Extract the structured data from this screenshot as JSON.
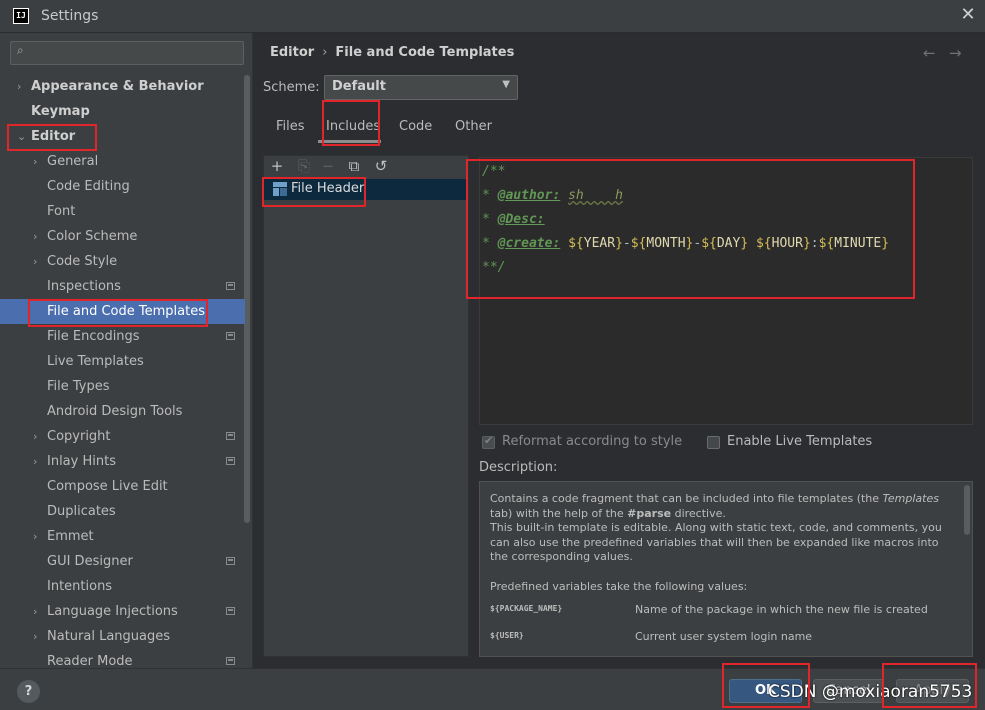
{
  "window": {
    "title": "Settings",
    "app_icon_text": "IJ"
  },
  "search": {
    "placeholder": ""
  },
  "sidebar": {
    "items": [
      {
        "label": "Appearance & Behavior",
        "chevron": "›",
        "bold": true
      },
      {
        "label": "Keymap",
        "bold": true
      },
      {
        "label": "Editor",
        "chevron": "⌄",
        "bold": true
      },
      {
        "label": "General",
        "chevron": "›"
      },
      {
        "label": "Code Editing"
      },
      {
        "label": "Font"
      },
      {
        "label": "Color Scheme",
        "chevron": "›"
      },
      {
        "label": "Code Style",
        "chevron": "›"
      },
      {
        "label": "Inspections",
        "project_icon": true
      },
      {
        "label": "File and Code Templates",
        "selected": true
      },
      {
        "label": "File Encodings",
        "project_icon": true
      },
      {
        "label": "Live Templates"
      },
      {
        "label": "File Types"
      },
      {
        "label": "Android Design Tools"
      },
      {
        "label": "Copyright",
        "chevron": "›",
        "project_icon": true
      },
      {
        "label": "Inlay Hints",
        "chevron": "›",
        "project_icon": true
      },
      {
        "label": "Compose Live Edit"
      },
      {
        "label": "Duplicates"
      },
      {
        "label": "Emmet",
        "chevron": "›"
      },
      {
        "label": "GUI Designer",
        "project_icon": true
      },
      {
        "label": "Intentions"
      },
      {
        "label": "Language Injections",
        "chevron": "›",
        "project_icon": true
      },
      {
        "label": "Natural Languages",
        "chevron": "›"
      },
      {
        "label": "Reader Mode",
        "project_icon": true
      }
    ]
  },
  "breadcrumb": {
    "parent": "Editor",
    "separator": "›",
    "current": "File and Code Templates"
  },
  "nav": {
    "back": "←",
    "forward": "→"
  },
  "scheme": {
    "label": "Scheme:",
    "value": "Default"
  },
  "tabs": [
    {
      "label": "Files"
    },
    {
      "label": "Includes",
      "active": true
    },
    {
      "label": "Code"
    },
    {
      "label": "Other"
    }
  ],
  "toolbar": {
    "add": "+",
    "copy_disabled": "⎘",
    "remove": "−",
    "duplicate": "⧉",
    "reset": "↺"
  },
  "templates": [
    {
      "label": "File Header"
    }
  ],
  "editor": {
    "l1": "/**",
    "l2_prefix": "* ",
    "l2_tag": "@author:",
    "l2_value": "sh    h",
    "l3_prefix": "* ",
    "l3_tag": "@Desc:",
    "l4_prefix": "* ",
    "l4_tag": "@create:",
    "year": "YEAR",
    "month": "MONTH",
    "day": "DAY",
    "hour": "HOUR",
    "minute": "MINUTE",
    "l5": "**/"
  },
  "options": {
    "reformat": "Reformat according to style",
    "live_templates": "Enable Live Templates"
  },
  "description": {
    "title": "Description:",
    "p1_a": "Contains a code fragment that can be included into file templates (the ",
    "p1_em": "Templates",
    "p1_b": " tab) with the help of the ",
    "p1_bold": "#parse",
    "p1_c": " directive.",
    "p2": "This built-in template is editable. Along with static text, code, and comments, you can also use the predefined variables that will then be expanded like macros into the corresponding values.",
    "p3": "Predefined variables take the following values:",
    "vars": [
      {
        "name": "${PACKAGE_NAME}",
        "desc": "Name of the package in which the new file is created"
      },
      {
        "name": "${USER}",
        "desc": "Current user system login name"
      }
    ]
  },
  "buttons": {
    "help": "?",
    "ok": "OK",
    "cancel": "Cancel",
    "apply": "Apply"
  },
  "watermark": "CSDN @moxiaoran5753",
  "colors": {
    "accent": "#4b6eaf",
    "highlight": "#e0262a",
    "ok_button": "#365880"
  }
}
